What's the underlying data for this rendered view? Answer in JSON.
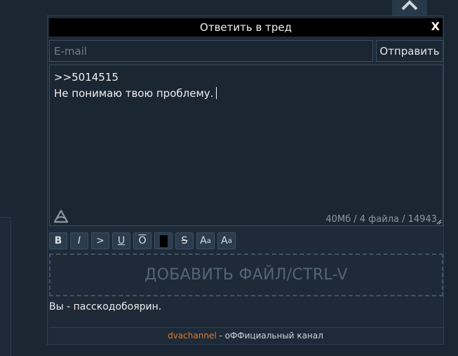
{
  "form": {
    "title": "Ответить в тред",
    "close_label": "X",
    "email_placeholder": "E-mail",
    "email_value": "",
    "send_label": "Отправить",
    "message_lines": [
      ">>5014515",
      "Не понимаю твою проблему."
    ],
    "limits": "40Мб / 4 файла / 14943"
  },
  "toolbar": {
    "bold": "B",
    "italic": "I",
    "quote": ">",
    "underline": "U",
    "overline": "O",
    "strike": "S",
    "sup_base": "A",
    "sup_mark": "a",
    "sub_base": "A",
    "sub_mark": "a"
  },
  "dropzone": {
    "label": "ДОБАВИТЬ ФАЙЛ/CTRL-V"
  },
  "status": {
    "text": "Вы - пасскодобоярин."
  },
  "footer": {
    "link_text": "dvachannel",
    "rest": " - оФФициальный канал"
  },
  "icons": {
    "scroll_top": "chevron-up-icon",
    "brand": "dvach-logo-icon",
    "resize": "resize-handle-icon"
  },
  "colors": {
    "page_bg": "#1b2633",
    "panel_bg": "#1e2a37",
    "titlebar_bg": "#000000",
    "accent_link": "#e07a2f",
    "button_bg": "#2b3c4e"
  }
}
